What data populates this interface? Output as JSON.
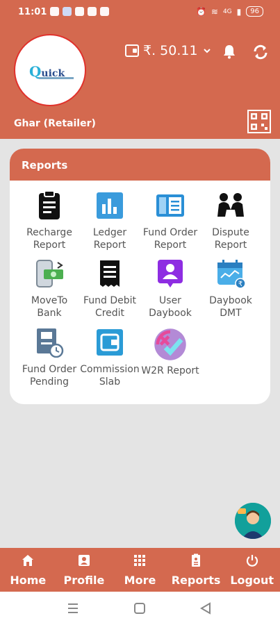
{
  "status_bar": {
    "time": "11:01",
    "network": "4G",
    "battery": "96"
  },
  "header": {
    "logo_text": "uick",
    "logo_initial": "Q",
    "wallet_balance": "₹. 50.11",
    "shop_name": "Ghar (Retailer)"
  },
  "reports": {
    "title": "Reports",
    "items": [
      {
        "label_1": "Recharge",
        "label_2": "Report",
        "icon": "clipboard-icon"
      },
      {
        "label_1": "Ledger",
        "label_2": "Report",
        "icon": "bar-chart-icon"
      },
      {
        "label_1": "Fund Order",
        "label_2": "Report",
        "icon": "fund-order-icon"
      },
      {
        "label_1": "Dispute",
        "label_2": "Report",
        "icon": "dispute-icon"
      },
      {
        "label_1": "MoveTo",
        "label_2": "Bank",
        "icon": "phone-cash-icon"
      },
      {
        "label_1": "Fund Debit",
        "label_2": "Credit",
        "icon": "receipt-icon"
      },
      {
        "label_1": "User",
        "label_2": "Daybook",
        "icon": "user-daybook-icon"
      },
      {
        "label_1": "Daybook",
        "label_2": "DMT",
        "icon": "calendar-rupee-icon"
      },
      {
        "label_1": "Fund Order",
        "label_2": "Pending",
        "icon": "pending-clock-icon"
      },
      {
        "label_1": "Commission",
        "label_2": "Slab",
        "icon": "wallet-icon"
      },
      {
        "label_1": "W2R Report",
        "label_2": "",
        "icon": "check-cross-icon"
      }
    ]
  },
  "bottom_nav": {
    "items": [
      {
        "label": "Home",
        "icon": "home-icon"
      },
      {
        "label": "Profile",
        "icon": "profile-icon"
      },
      {
        "label": "More",
        "icon": "grid-icon"
      },
      {
        "label": "Reports",
        "icon": "report-icon"
      },
      {
        "label": "Logout",
        "icon": "power-icon"
      }
    ]
  },
  "colors": {
    "brand": "#d4694f",
    "background": "#e4e4e4"
  }
}
